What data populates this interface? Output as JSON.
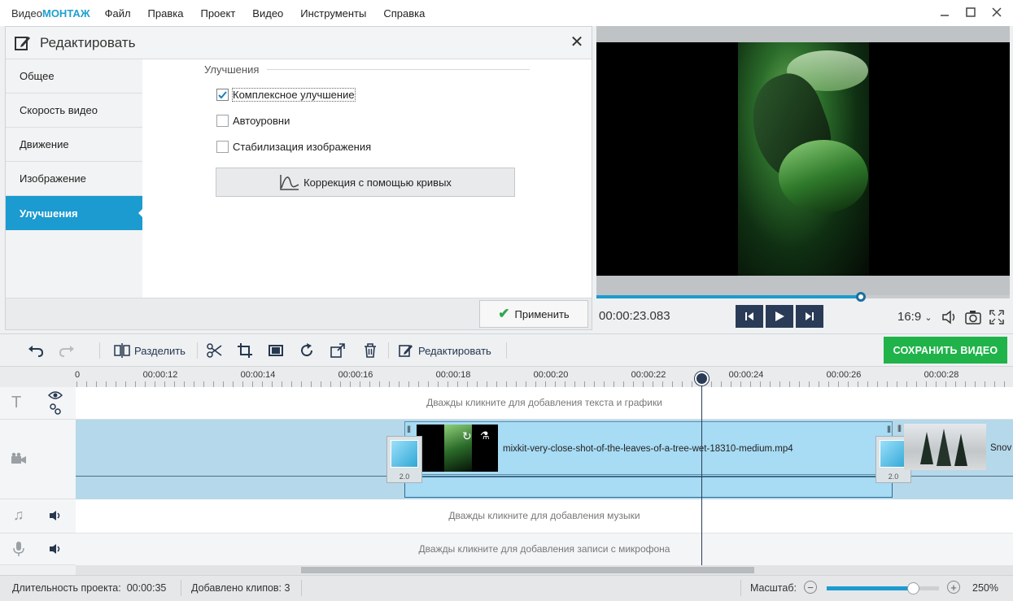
{
  "app": {
    "logo_prefix": "Видео",
    "logo_brand": "МОНТАЖ"
  },
  "menu": [
    "Файл",
    "Правка",
    "Проект",
    "Видео",
    "Инструменты",
    "Справка"
  ],
  "edit_panel": {
    "title": "Редактировать",
    "sidebar": [
      "Общее",
      "Скорость видео",
      "Движение",
      "Изображение",
      "Улучшения"
    ],
    "active_index": 4,
    "section_title": "Улучшения",
    "options": [
      {
        "label": "Комплексное улучшение",
        "checked": true
      },
      {
        "label": "Автоуровни",
        "checked": false
      },
      {
        "label": "Стабилизация изображения",
        "checked": false
      }
    ],
    "curves_button": "Коррекция с помощью кривых",
    "apply_button": "Применить"
  },
  "player": {
    "time": "00:00:23.083",
    "progress": 0.64,
    "aspect": "16:9"
  },
  "toolbar": {
    "split": "Разделить",
    "edit": "Редактировать",
    "save": "СОХРАНИТЬ ВИДЕО"
  },
  "timeline": {
    "ruler_labels": [
      "0",
      "00:00:12",
      "00:00:14",
      "00:00:16",
      "00:00:18",
      "00:00:20",
      "00:00:22",
      "00:00:24",
      "00:00:26",
      "00:00:28"
    ],
    "text_track_hint": "Дважды кликните для добавления текста и графики",
    "music_track_hint": "Дважды кликните для добавления музыки",
    "mic_track_hint": "Дважды кликните для добавления записи с микрофона",
    "clip_name": "mixkit-very-close-shot-of-the-leaves-of-a-tree-wet-18310-medium.mp4",
    "next_clip_name": "Snov",
    "transition_label_1": "2.0",
    "transition_label_2": "2.0"
  },
  "status": {
    "duration_label": "Длительность проекта:",
    "duration": "00:00:35",
    "clips_label": "Добавлено клипов:",
    "clips": "3",
    "zoom_label": "Масштаб:",
    "zoom": "250%",
    "zoom_level": 0.77
  },
  "colors": {
    "accent": "#1b9bd0",
    "save": "#1fb34a",
    "dark": "#2a3b57"
  }
}
